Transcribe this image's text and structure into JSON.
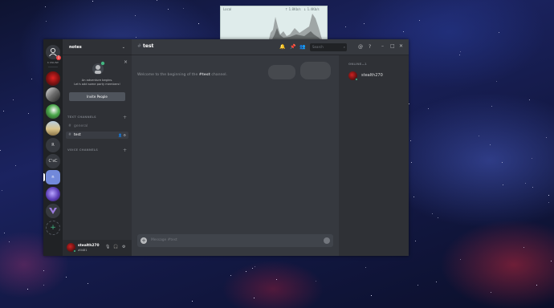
{
  "network_widget": {
    "title": "Local",
    "up": "↑ 1.8Kb/s",
    "down": "↓ 1.4Kb/s"
  },
  "sidebar": {
    "home_badge": "1",
    "online_label": "6 ONLINE",
    "guild_letters": {
      "r": "R",
      "csc": "C'sC",
      "n": "n"
    }
  },
  "guild": {
    "name": "notes",
    "invite": {
      "line1": "An adventure begins.",
      "line2": "Let's add some party members!",
      "button": "Invite People"
    },
    "text_category": "TEXT CHANNELS",
    "voice_category": "VOICE CHANNELS",
    "channels": [
      {
        "name": "general"
      },
      {
        "name": "test"
      }
    ]
  },
  "user": {
    "name": "stealth270",
    "tag": "#0481"
  },
  "channel_header": {
    "name": "test",
    "search_placeholder": "Search"
  },
  "chat": {
    "welcome_prefix": "Welcome to the beginning of the ",
    "welcome_channel": "#test",
    "welcome_suffix": " channel.",
    "composer_placeholder": "Message #test"
  },
  "members": {
    "category": "ONLINE—1",
    "list": [
      {
        "name": "stealth270"
      }
    ]
  },
  "colors": {
    "online": "#43b581",
    "badge": "#f04747",
    "active_guild": "#7289da"
  }
}
